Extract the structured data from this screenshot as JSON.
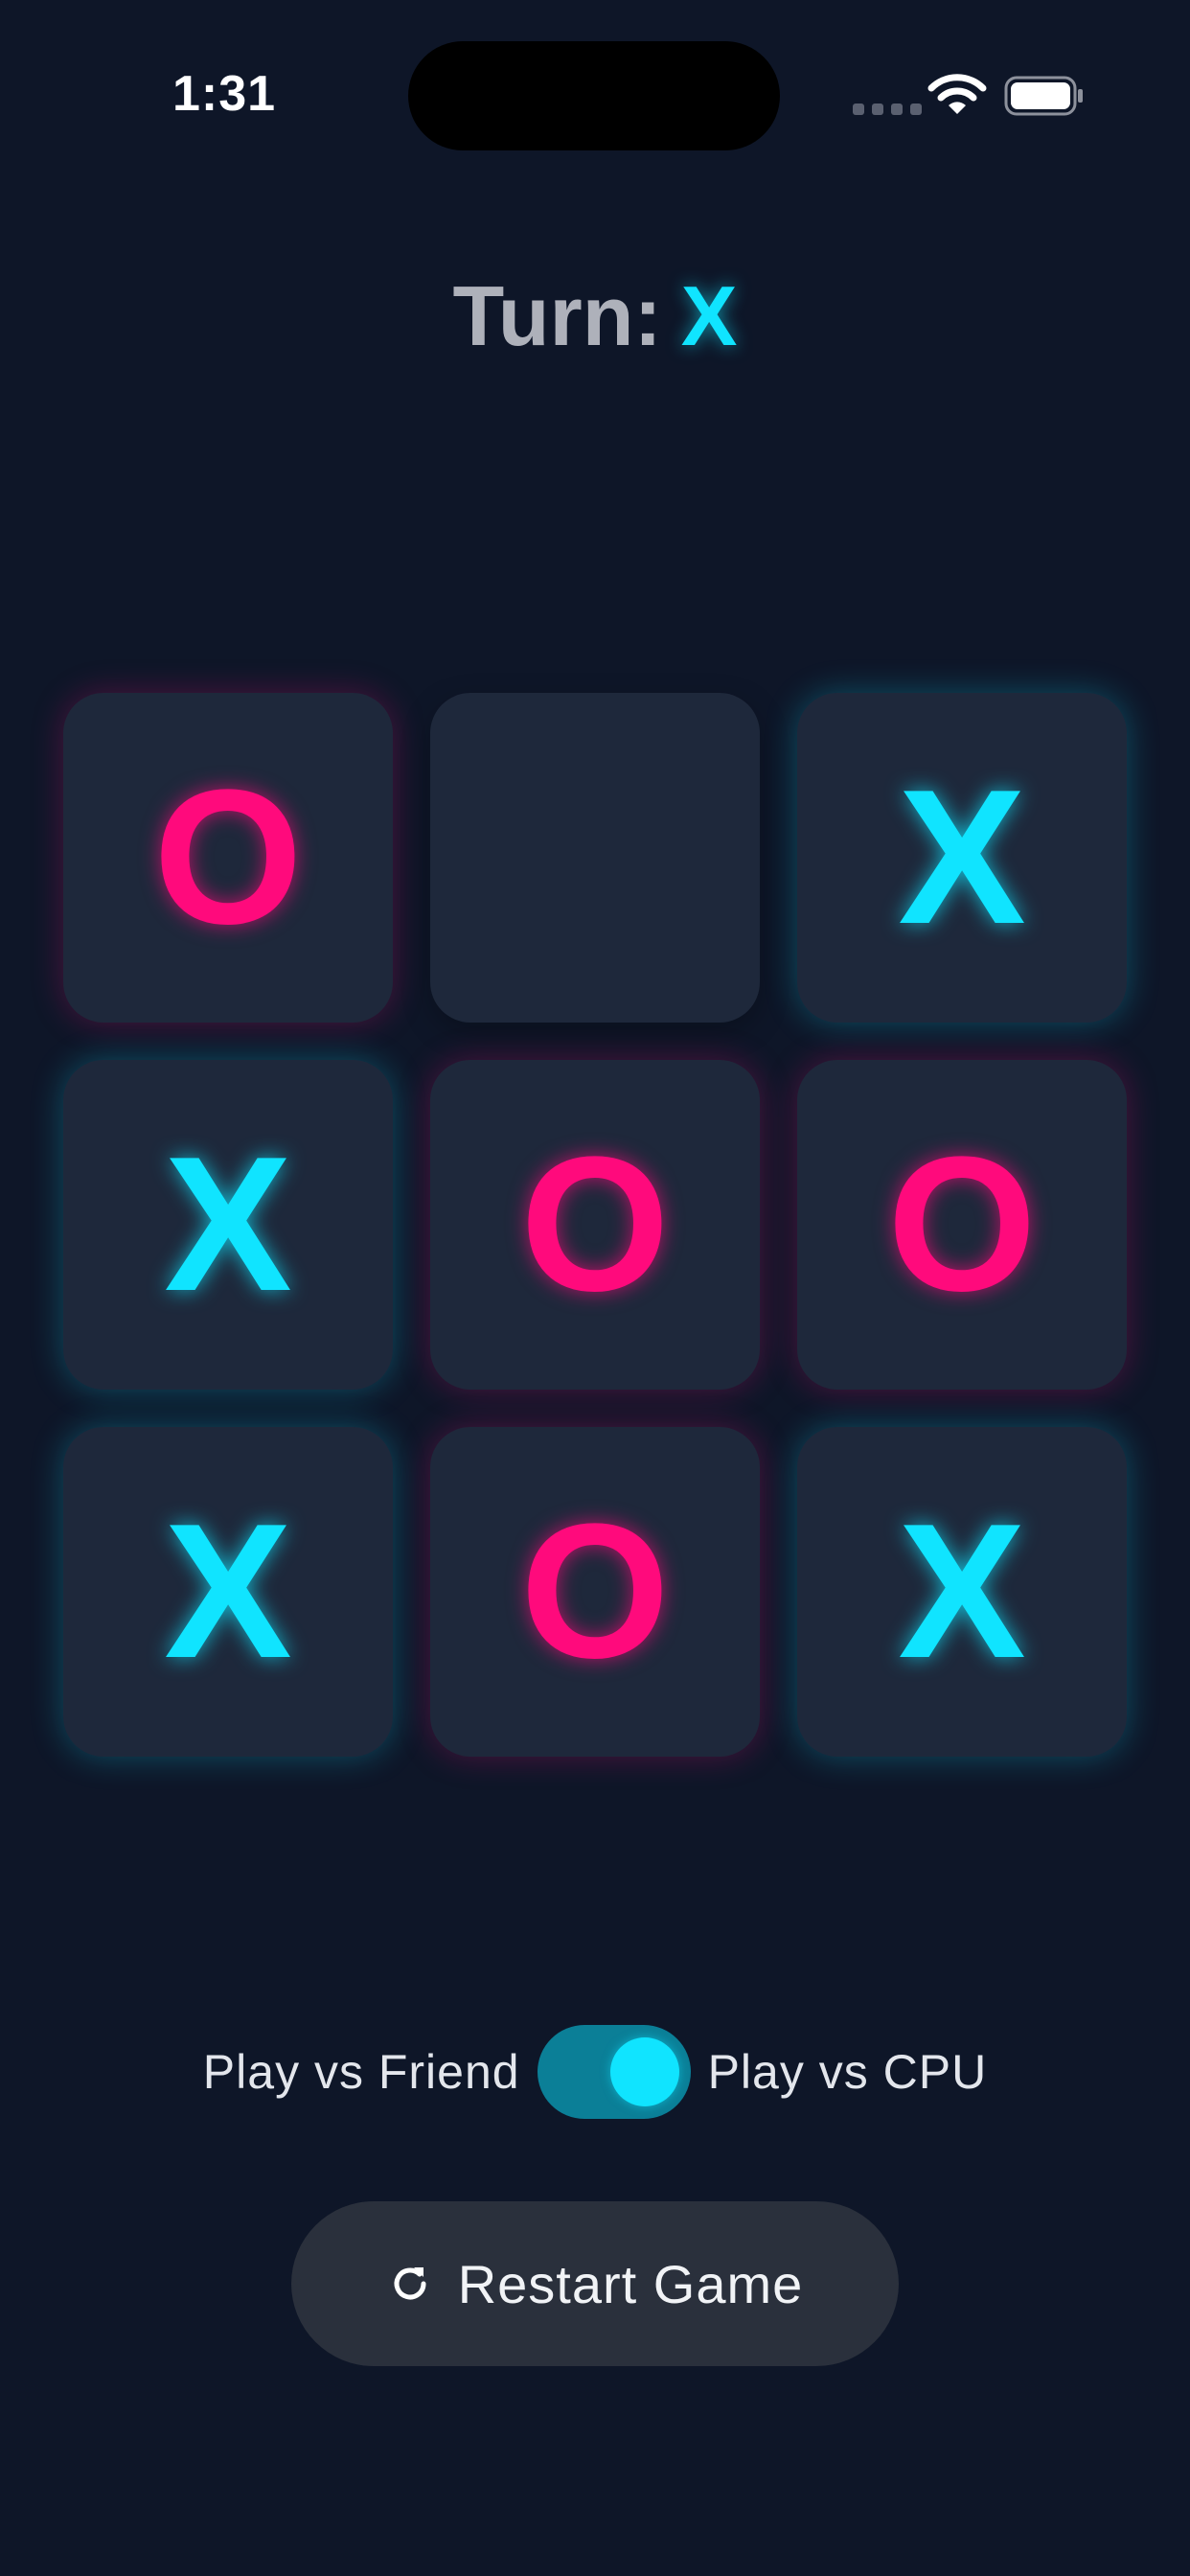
{
  "status_bar": {
    "time": "1:31"
  },
  "turn": {
    "label": "Turn:",
    "symbol": "X"
  },
  "board": {
    "cells": [
      "O",
      "",
      "X",
      "X",
      "O",
      "O",
      "X",
      "O",
      "X"
    ]
  },
  "mode": {
    "left_label": "Play vs Friend",
    "right_label": "Play vs CPU",
    "cpu_enabled": true
  },
  "restart": {
    "label": "Restart Game"
  },
  "colors": {
    "background": "#0e1628",
    "cell": "#1e283b",
    "x": "#10e4ff",
    "o": "#ff0a7c",
    "toggle_track": "#0b7f97",
    "button": "#2a303c"
  },
  "icons": {
    "wifi": "wifi-icon",
    "battery": "battery-icon",
    "restart": "refresh-icon"
  }
}
